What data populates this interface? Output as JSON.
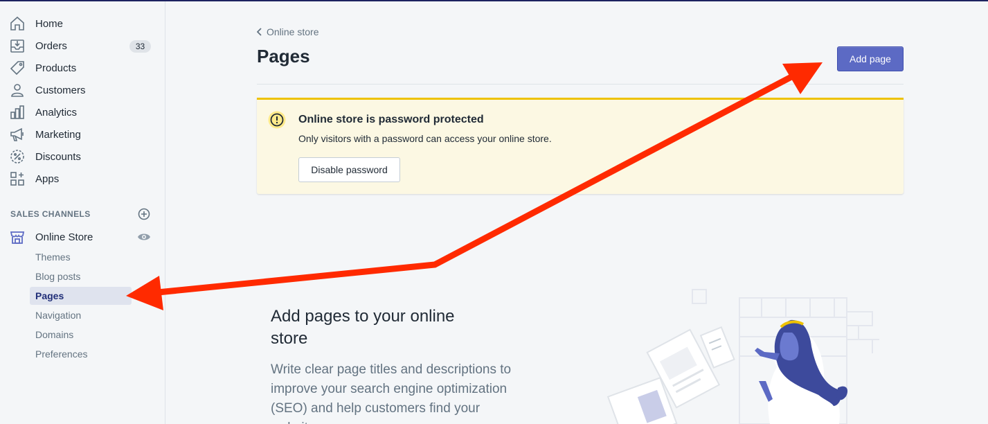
{
  "sidebar": {
    "items": [
      {
        "label": "Home",
        "icon": "home-icon"
      },
      {
        "label": "Orders",
        "icon": "orders-icon",
        "badge": "33"
      },
      {
        "label": "Products",
        "icon": "tag-icon"
      },
      {
        "label": "Customers",
        "icon": "person-icon"
      },
      {
        "label": "Analytics",
        "icon": "bar-chart-icon"
      },
      {
        "label": "Marketing",
        "icon": "megaphone-icon"
      },
      {
        "label": "Discounts",
        "icon": "discount-icon"
      },
      {
        "label": "Apps",
        "icon": "apps-icon"
      }
    ],
    "sales_channels_title": "SALES CHANNELS",
    "online_store": {
      "label": "Online Store",
      "sub_items": [
        "Themes",
        "Blog posts",
        "Pages",
        "Navigation",
        "Domains",
        "Preferences"
      ],
      "active": "Pages"
    }
  },
  "main": {
    "breadcrumb": "Online store",
    "title": "Pages",
    "add_button": "Add page",
    "banner": {
      "title": "Online store is password protected",
      "text": "Only visitors with a password can access your online store.",
      "button": "Disable password"
    },
    "empty_state": {
      "title": "Add pages to your online store",
      "description": "Write clear page titles and descriptions to improve your search engine optimization (SEO) and help customers find your website."
    }
  },
  "colors": {
    "accent": "#5c6ac4",
    "active_nav": "#202e78",
    "warning_border": "#eec200",
    "warning_bg": "#fcf8e3",
    "annotation_arrow": "#ff2a00"
  }
}
